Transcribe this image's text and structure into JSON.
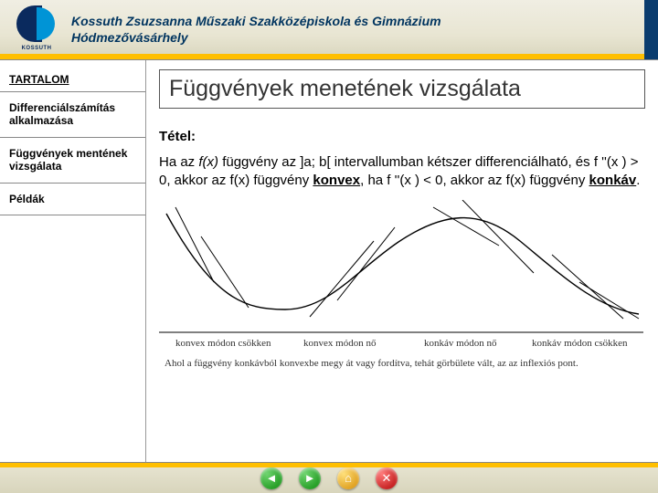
{
  "header": {
    "school": "Kossuth Zsuzsanna Műszaki Szakközépiskola és Gimnázium",
    "city": "Hódmezővásárhely",
    "logo_label": "KOSSUTH"
  },
  "sidebar": {
    "heading": "TARTALOM",
    "items": [
      {
        "label": "Differenciálszámítás alkalmazása"
      },
      {
        "label": "Függvények mentének vizsgálata"
      },
      {
        "label": "Példák"
      }
    ]
  },
  "main": {
    "title": "Függvények  menetének vizsgálata",
    "section_label": "Tétel:",
    "theorem_parts": {
      "p1": "Ha az ",
      "fx": "f(x)",
      "p2": " függvény az  ]a; b[  intervallumban kétszer differenciálható, és   f ''(x ) > 0,  akkor az f(x) függvény ",
      "konvex": "konvex",
      "p3": ", ha f ''(x ) < 0, akkor az f(x) függvény ",
      "konkav": "konkáv",
      "p4": "."
    }
  },
  "diagram": {
    "labels": [
      "konvex módon csökken",
      "konvex módon nő",
      "konkáv módon nő",
      "konkáv módon csökken"
    ],
    "caption": "Ahol a függvény konkávból konvexbe megy át vagy fordítva, tehát görbülete vált, az az inflexiós pont."
  },
  "footer": {
    "buttons": [
      "back",
      "forward",
      "home",
      "close"
    ]
  }
}
